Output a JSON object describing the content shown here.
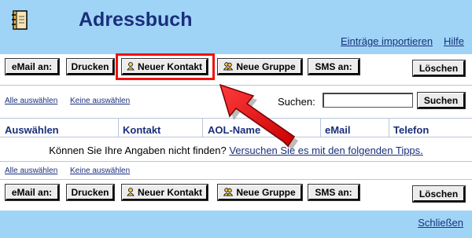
{
  "header": {
    "title": "Adressbuch",
    "import_link": "Einträge importieren",
    "help_link": "Hilfe"
  },
  "toolbar_top": {
    "email": "eMail an:",
    "print": "Drucken",
    "new_contact": "Neuer Kontakt",
    "new_group": "Neue Gruppe",
    "sms": "SMS an:",
    "delete": "Löschen"
  },
  "selection_top": {
    "select_all": "Alle auswählen",
    "select_none": "Keine auswählen"
  },
  "search": {
    "label": "Suchen:",
    "value": "",
    "button": "Suchen"
  },
  "table": {
    "columns": [
      "Auswählen",
      "Kontakt",
      "AOL-Name",
      "eMail",
      "Telefon"
    ]
  },
  "notice": {
    "text": "Können Sie Ihre Angaben nicht finden?",
    "link": "Versuchen Sie es mit den folgenden Tipps."
  },
  "selection_bottom": {
    "select_all": "Alle auswählen",
    "select_none": "Keine auswählen"
  },
  "toolbar_bottom": {
    "email": "eMail an:",
    "print": "Drucken",
    "new_contact": "Neuer Kontakt",
    "new_group": "Neue Gruppe",
    "sms": "SMS an:",
    "delete": "Löschen"
  },
  "footer": {
    "close_link": "Schließen"
  },
  "colors": {
    "bar": "#9fd4f7",
    "title": "#1a2f7a",
    "highlight": "#e11111"
  }
}
